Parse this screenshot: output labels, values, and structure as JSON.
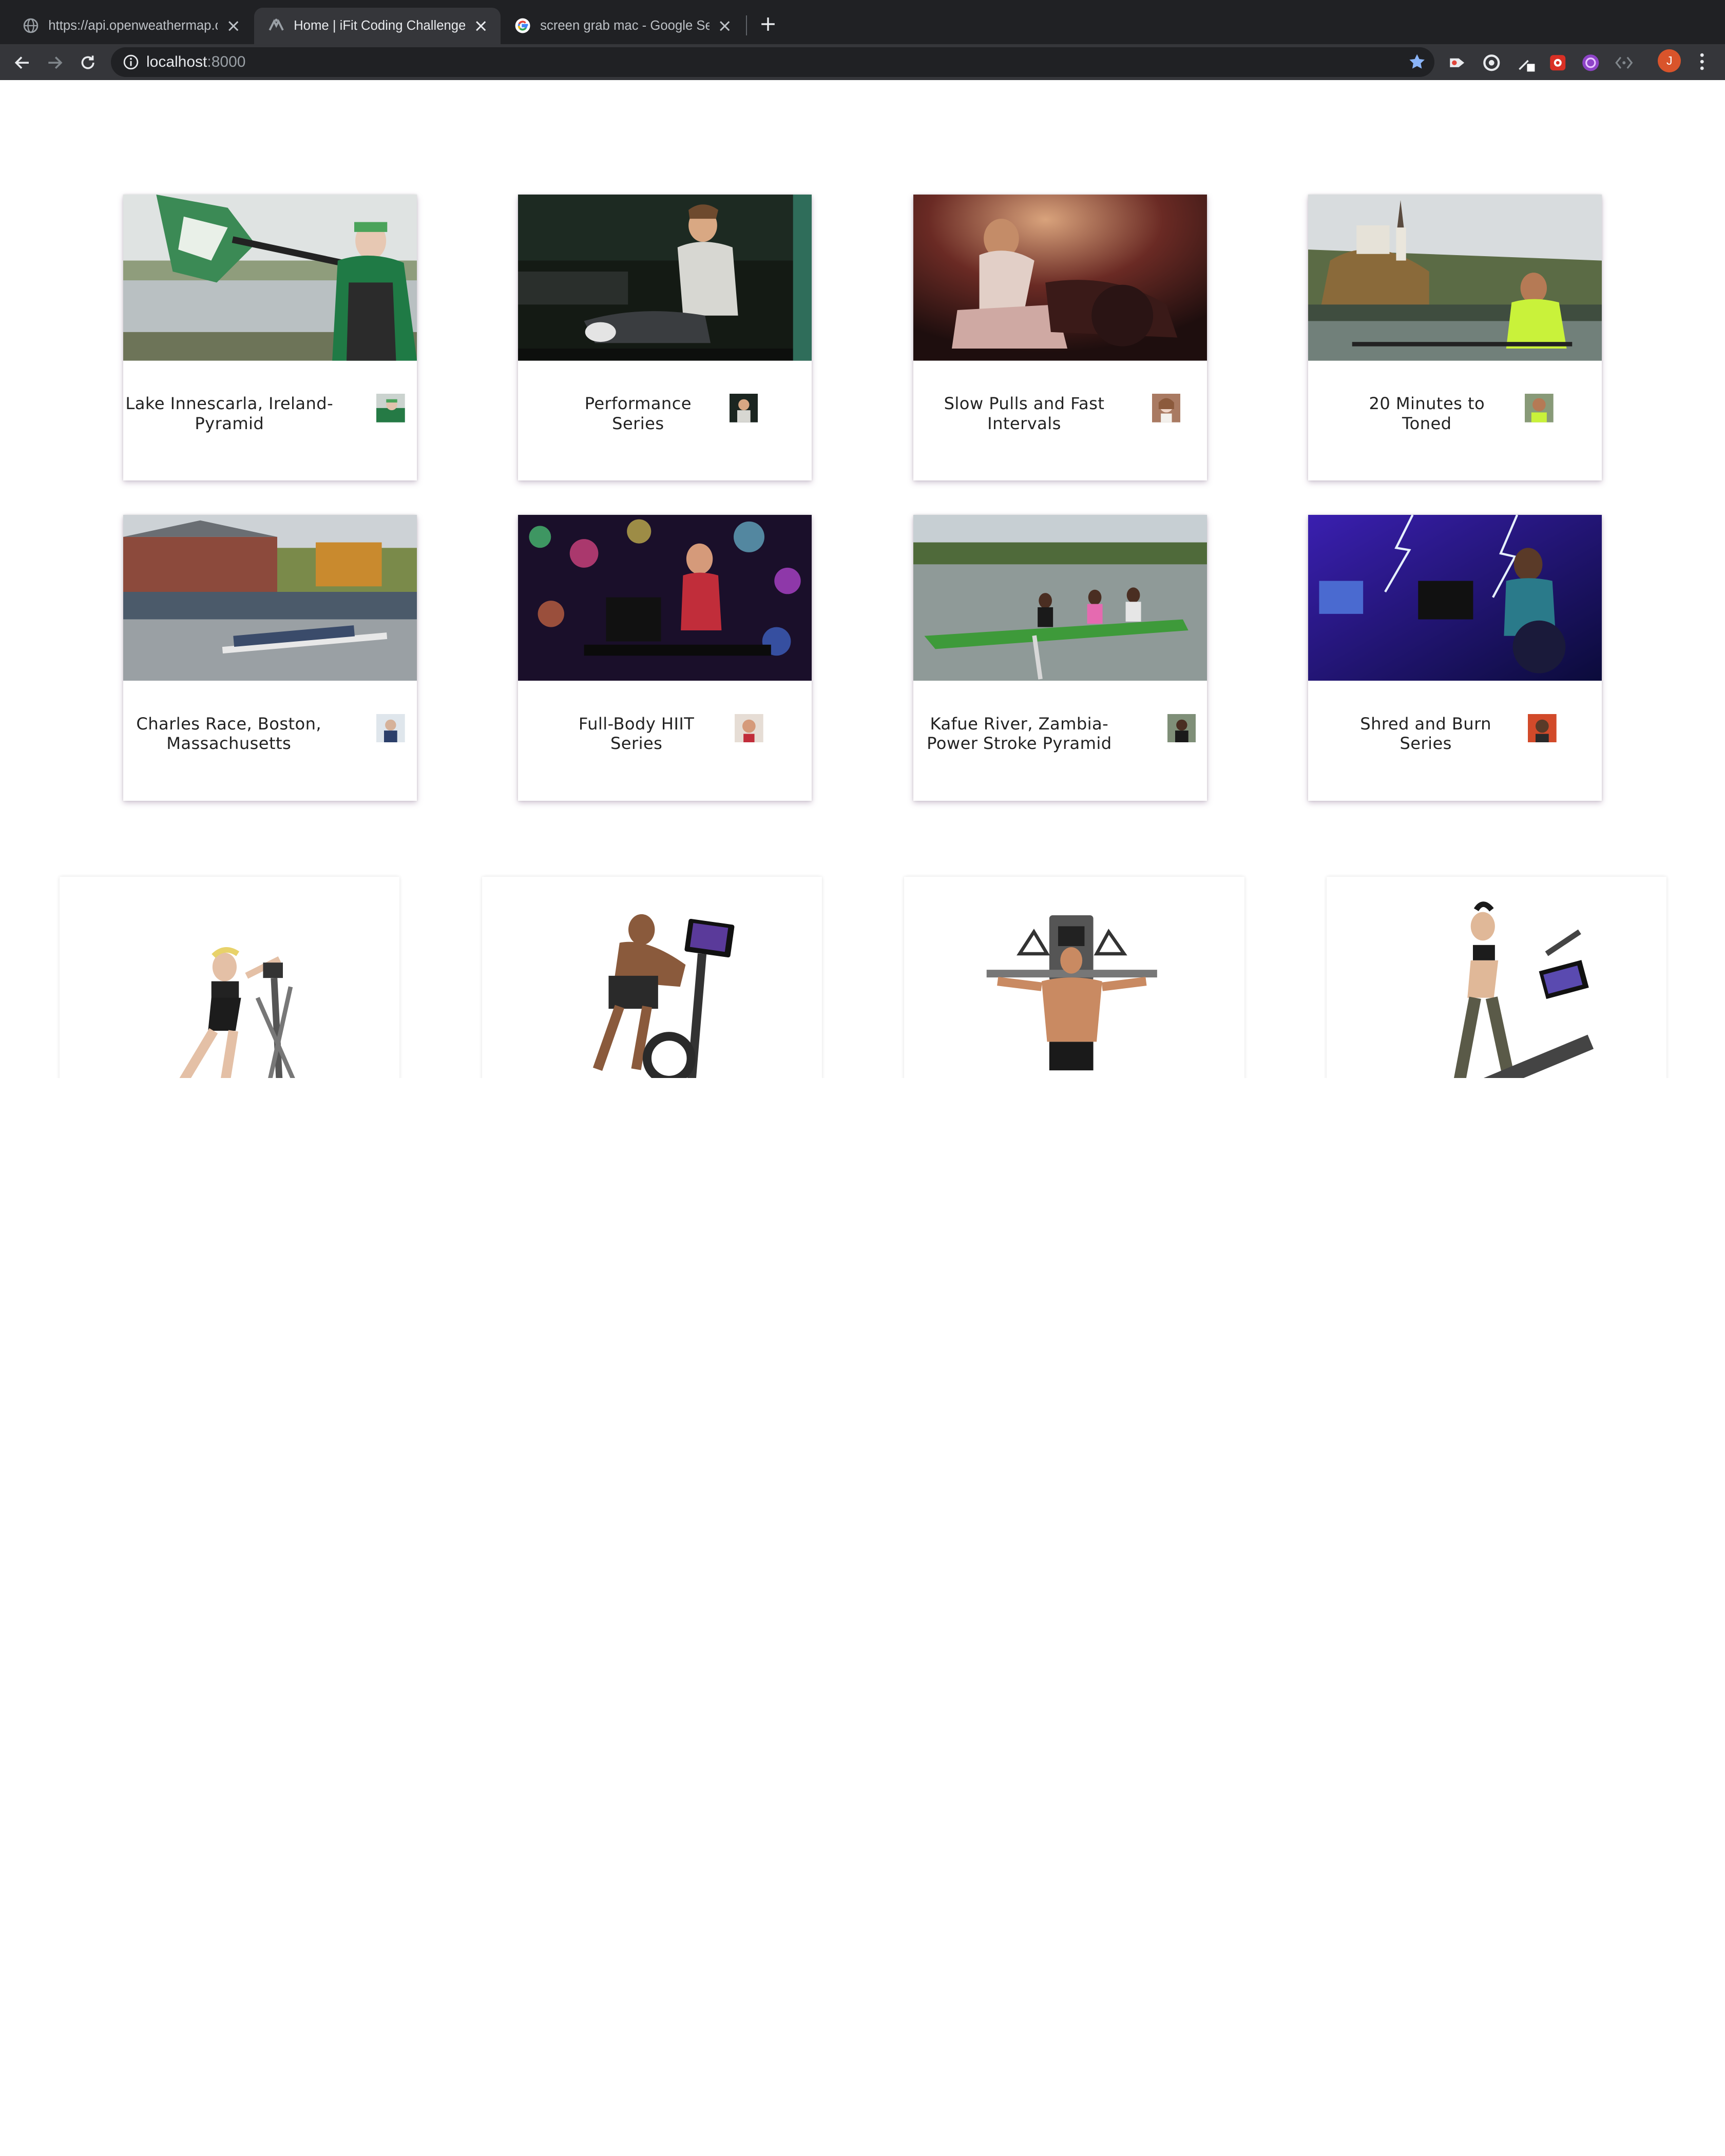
{
  "browser": {
    "tabs": [
      {
        "title": "https://api.openweathermap.org/data/",
        "favicon": "globe-icon",
        "active": false
      },
      {
        "title": "Home | iFit Coding Challenge",
        "favicon": "ifit-logo-icon",
        "active": true
      },
      {
        "title": "screen grab mac - Google Search",
        "favicon": "google-g-icon",
        "active": false
      }
    ],
    "address": {
      "host": "localhost",
      "port": ":8000"
    },
    "profile_initial": "J",
    "extensions": [
      "video-extension-icon",
      "circle-extension-icon",
      "eyedropper-extension-icon",
      "red-extension-icon",
      "purple-extension-icon",
      "code-extension-icon"
    ]
  },
  "workouts": [
    {
      "title_lines": [
        "Lake Innescarla, Ireland-",
        "Pyramid"
      ]
    },
    {
      "title_lines": [
        "Performance",
        "Series"
      ]
    },
    {
      "title_lines": [
        "Slow Pulls and Fast",
        "Intervals"
      ]
    },
    {
      "title_lines": [
        "20 Minutes to",
        "Toned"
      ]
    },
    {
      "title_lines": [
        "Charles Race, Boston,",
        "Massachusetts"
      ]
    },
    {
      "title_lines": [
        "Full-Body HIIT",
        "Series"
      ]
    },
    {
      "title_lines": [
        "Kafue River, Zambia-",
        "Power Stroke Pyramid"
      ]
    },
    {
      "title_lines": [
        "Shred and Burn",
        "Series"
      ]
    }
  ],
  "equipment": [
    {
      "name": "elliptical-image"
    },
    {
      "name": "exercise-bike-image"
    },
    {
      "name": "strength-machine-image"
    },
    {
      "name": "treadmill-image"
    }
  ],
  "colors": {
    "tabstrip": "#202124",
    "toolbar": "#35363a",
    "accent_star": "#8ab4f8",
    "profile": "#d9542b"
  }
}
